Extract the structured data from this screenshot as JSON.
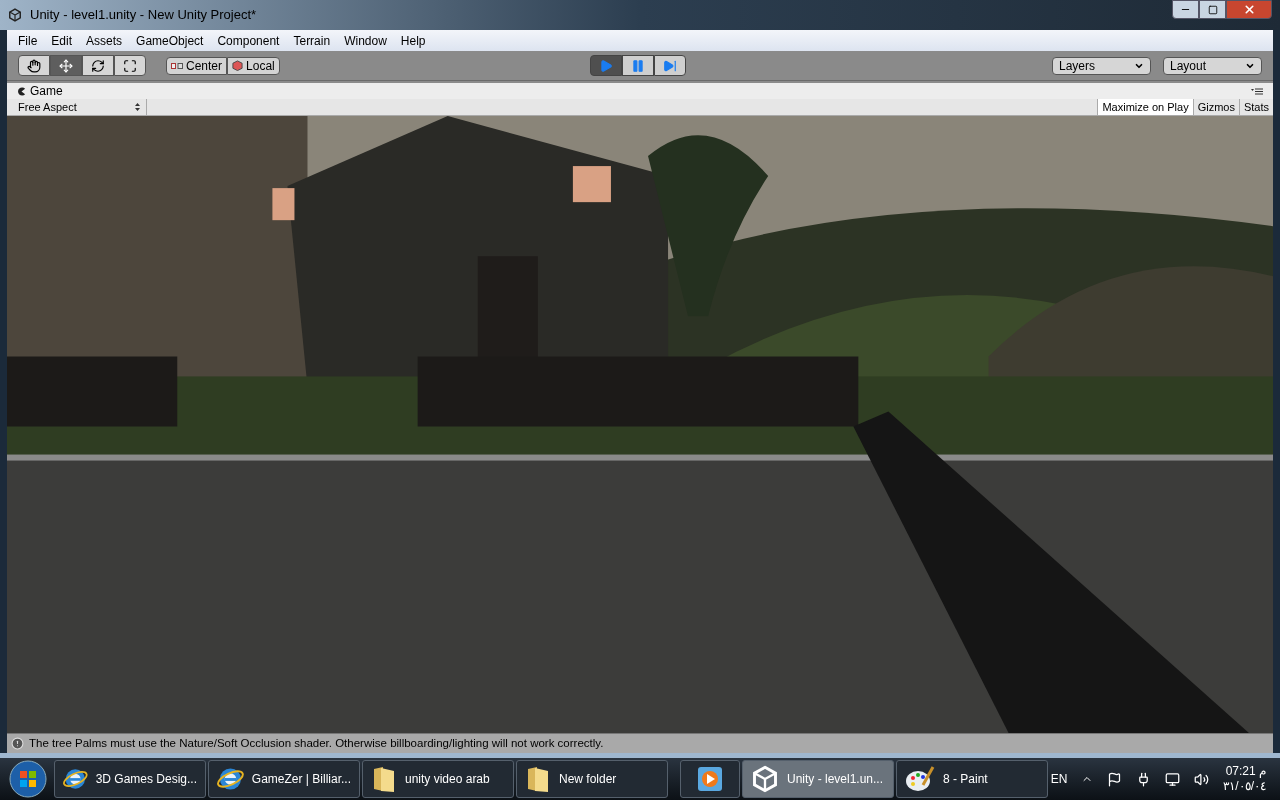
{
  "window": {
    "title": "Unity - level1.unity - New Unity Project*"
  },
  "menu": [
    "File",
    "Edit",
    "Assets",
    "GameObject",
    "Component",
    "Terrain",
    "Window",
    "Help"
  ],
  "toolbar": {
    "tools": [
      {
        "kind": "hand",
        "selected": false
      },
      {
        "kind": "move",
        "selected": true
      },
      {
        "kind": "rotate",
        "selected": false
      },
      {
        "kind": "scale",
        "selected": false
      }
    ],
    "pivot": [
      {
        "kind": "center",
        "label": "Center"
      },
      {
        "kind": "local",
        "label": "Local"
      }
    ],
    "playback": [
      {
        "kind": "play",
        "selected": true
      },
      {
        "kind": "pause",
        "selected": false
      },
      {
        "kind": "step",
        "selected": false
      }
    ],
    "dropdowns": [
      "Layers",
      "Layout"
    ]
  },
  "game": {
    "tab": "Game",
    "aspect": "Free Aspect",
    "toggles": [
      {
        "label": "Maximize on Play",
        "selected": true
      },
      {
        "label": "Gizmos",
        "selected": false
      },
      {
        "label": "Stats",
        "selected": false
      }
    ]
  },
  "status": "The tree Palms must use the Nature/Soft Occlusion shader. Otherwise billboarding/lighting will not work correctly.",
  "taskbar": {
    "items": [
      {
        "kind": "browser",
        "label": "3D Games Desig...",
        "selected": false
      },
      {
        "kind": "browser",
        "label": "GameZer | Billiar...",
        "selected": false
      },
      {
        "kind": "folder",
        "label": "unity video arab",
        "selected": false
      },
      {
        "kind": "folder",
        "label": "New folder",
        "selected": false
      },
      {
        "kind": "media",
        "selected": false
      },
      {
        "kind": "unity",
        "label": "Unity - level1.un...",
        "selected": true
      },
      {
        "kind": "paint",
        "label": "8 - Paint",
        "selected": false
      }
    ],
    "language": "EN",
    "time": "07:21 م",
    "date": "٣١/٠٥/٠٤"
  }
}
